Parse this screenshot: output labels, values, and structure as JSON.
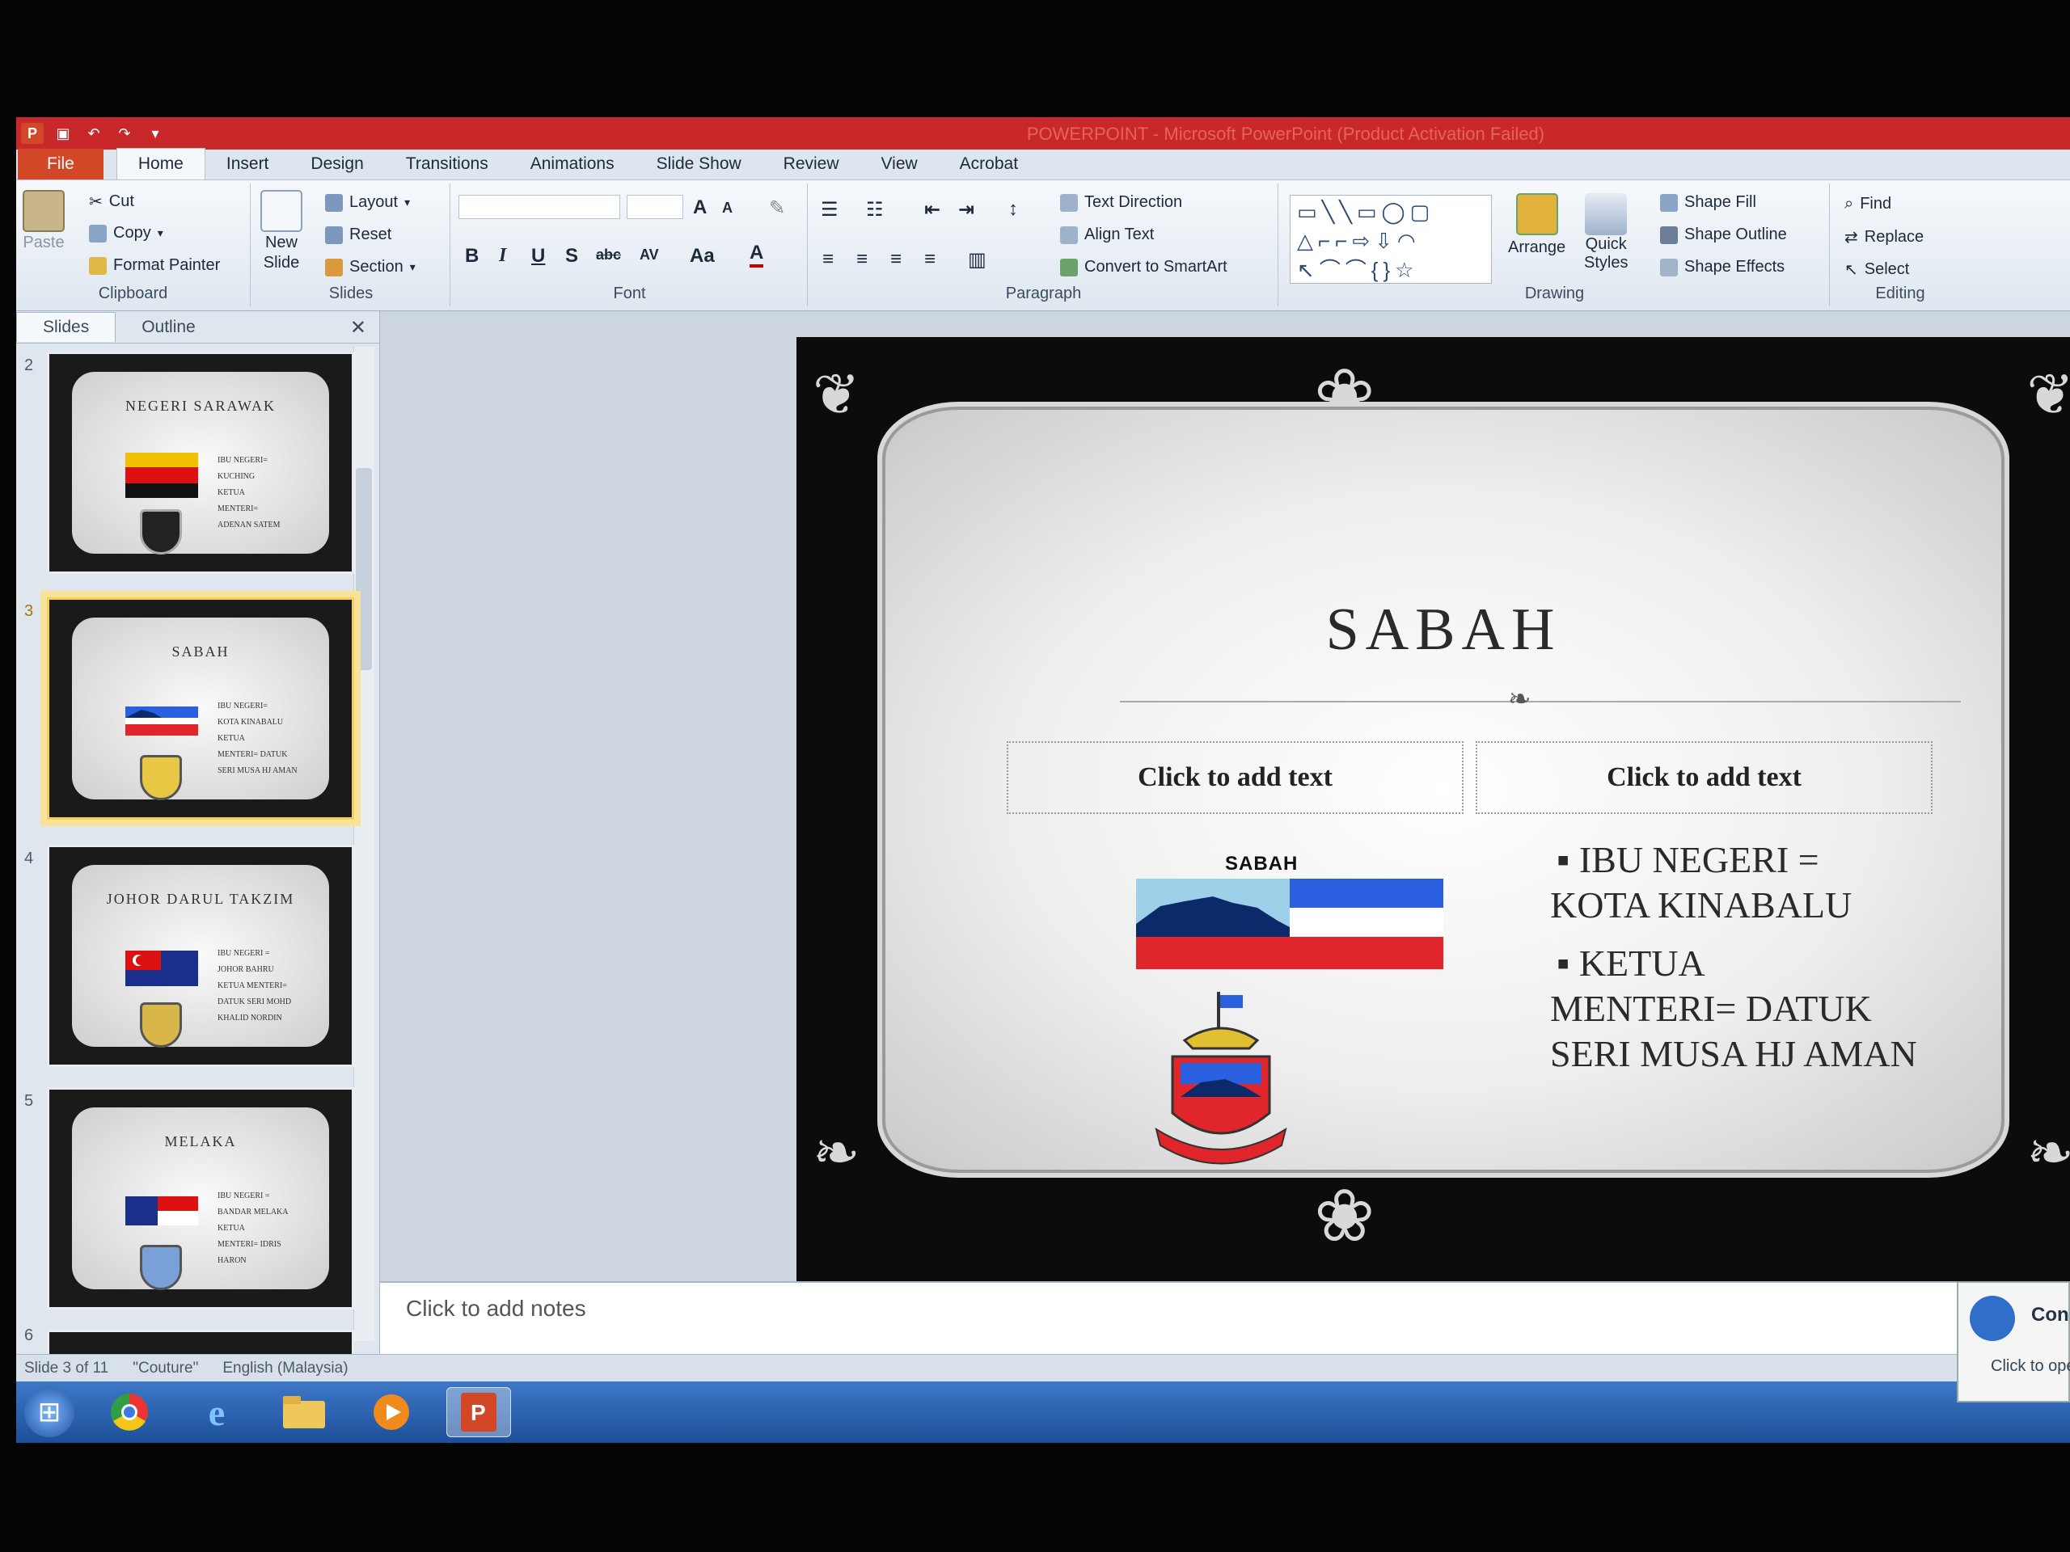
{
  "window": {
    "title": "POWERPOINT - Microsoft PowerPoint (Product Activation Failed)"
  },
  "tabs": [
    "File",
    "Home",
    "Insert",
    "Design",
    "Transitions",
    "Animations",
    "Slide Show",
    "Review",
    "View",
    "Acrobat"
  ],
  "ribbon": {
    "clipboard": {
      "label": "Clipboard",
      "paste": "Paste",
      "cut": "Cut",
      "copy": "Copy",
      "format_painter": "Format Painter"
    },
    "slides": {
      "label": "Slides",
      "new_slide_1": "New",
      "new_slide_2": "Slide",
      "layout": "Layout",
      "reset": "Reset",
      "section": "Section"
    },
    "font": {
      "label": "Font"
    },
    "paragraph": {
      "label": "Paragraph",
      "text_direction": "Text Direction",
      "align_text": "Align Text",
      "convert_smartart": "Convert to SmartArt"
    },
    "drawing": {
      "label": "Drawing",
      "arrange": "Arrange",
      "quick_styles_1": "Quick",
      "quick_styles_2": "Styles",
      "shape_fill": "Shape Fill",
      "shape_outline": "Shape Outline",
      "shape_effects": "Shape Effects"
    },
    "editing": {
      "label": "Editing",
      "find": "Find",
      "replace": "Replace",
      "select": "Select"
    }
  },
  "panel": {
    "tab_slides": "Slides",
    "tab_outline": "Outline"
  },
  "thumbnails": [
    {
      "num": "2",
      "title": "NEGERI SARAWAK",
      "lines": [
        "IBU NEGERI=",
        "KUCHING",
        "KETUA",
        "MENTERI=",
        "ADENAN SATEM"
      ]
    },
    {
      "num": "3",
      "title": "SABAH",
      "lines": [
        "IBU NEGERI=",
        "KOTA KINABALU",
        "KETUA",
        "MENTERI= DATUK",
        "SERI MUSA HJ AMAN"
      ]
    },
    {
      "num": "4",
      "title": "JOHOR DARUL TAKZIM",
      "lines": [
        "IBU NEGERI =",
        "JOHOR BAHRU",
        "KETUA MENTERI=",
        "DATUK SERI MOHD",
        "KHALID NORDIN"
      ]
    },
    {
      "num": "5",
      "title": "MELAKA",
      "lines": [
        "IBU NEGERI =",
        "BANDAR MELAKA",
        "KETUA",
        "MENTERI= IDRIS",
        "HARON"
      ]
    },
    {
      "num": "6"
    }
  ],
  "slide": {
    "title": "SABAH",
    "placeholder_left": "Click to add text",
    "placeholder_right": "Click to add text",
    "flag_caption": "SABAH",
    "bullets": [
      "IBU NEGERI =",
      "KOTA KINABALU",
      "KETUA",
      "MENTERI= DATUK",
      "SERI MUSA HJ AMAN"
    ]
  },
  "notes": {
    "placeholder": "Click to add notes"
  },
  "status": {
    "slide": "Slide 3 of 11",
    "theme": "\"Couture\"",
    "language": "English (Malaysia)"
  },
  "toast": {
    "title": "Con",
    "body": "Click to ope"
  },
  "colors": {
    "ribbon_accent": "#c9282b",
    "file_tab": "#d24726",
    "sabah_blue": "#2a60e0",
    "sabah_red": "#e0262a",
    "sabah_navy": "#0a2a6a"
  }
}
